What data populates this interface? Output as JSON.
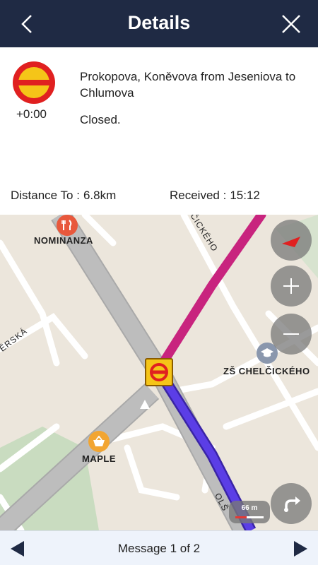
{
  "header": {
    "title": "Details",
    "back_icon": "chevron-left-icon",
    "close_icon": "close-icon"
  },
  "details": {
    "sign_icon": "road-closed-icon",
    "delay": "+0:00",
    "street": "Prokopova, Koněvova from Jeseniova to Chlumova",
    "status": "Closed.",
    "distance_label": "Distance To :",
    "distance_value": "6.8km",
    "received_label": "Received :",
    "received_value": "15:12"
  },
  "map": {
    "pois": [
      {
        "name": "NOMINANZA",
        "icon": "restaurant-icon",
        "color": "#e8583c"
      },
      {
        "name": "ZŠ CHELČICKÉHO",
        "icon": "school-icon",
        "color": "#8a97ad"
      },
      {
        "name": "MAPLE",
        "icon": "shopping-basket-icon",
        "color": "#f2a531"
      }
    ],
    "street_labels": [
      "ČICKÉHO",
      "ĚRSKÁ",
      "OLŠ"
    ],
    "scale": "66 m",
    "controls": {
      "compass": "compass-icon",
      "zoom_in": "zoom-in-icon",
      "zoom_out": "zoom-out-icon",
      "route": "route-turn-icon"
    },
    "colors": {
      "route_ahead": "#c8247e",
      "route_traveled": "#5b3ee6",
      "incident": "#f5c518"
    }
  },
  "footer": {
    "message": "Message 1 of 2",
    "prev_icon": "triangle-left-icon",
    "next_icon": "triangle-right-icon"
  }
}
